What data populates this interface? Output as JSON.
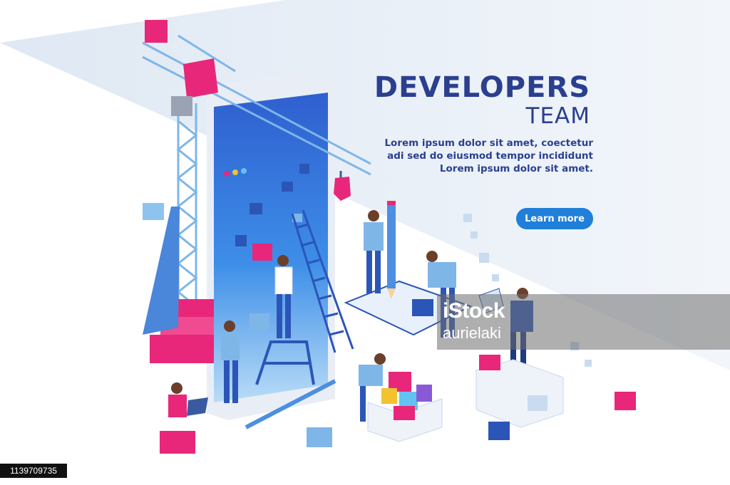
{
  "hero": {
    "headline_line1": "DEVELOPERS",
    "headline_line2": "TEAM",
    "body_lines": [
      "Lorem ipsum dolor sit amet, coectetur",
      "adi sed do eiusmod tempor incididunt",
      "Lorem ipsum dolor sit amet."
    ],
    "cta_label": "Learn more"
  },
  "watermark": {
    "brand": "iStock",
    "credit": "aurielaki"
  },
  "image_id_label": "1139709735",
  "colors": {
    "headline": "#2b3f8f",
    "cta_background": "#1f7fd9",
    "accent_pink": "#e8277a",
    "crane_blue": "#7fb6e8",
    "screen_blue": "#3f7ee0",
    "floor_shadow": "#e3ebf5"
  },
  "icons": [
    "tower-crane-icon",
    "smartphone-icon",
    "ladder-icon",
    "pencil-icon",
    "sharpener-icon",
    "laptop-icon",
    "tablet-icon",
    "cube-icon"
  ]
}
